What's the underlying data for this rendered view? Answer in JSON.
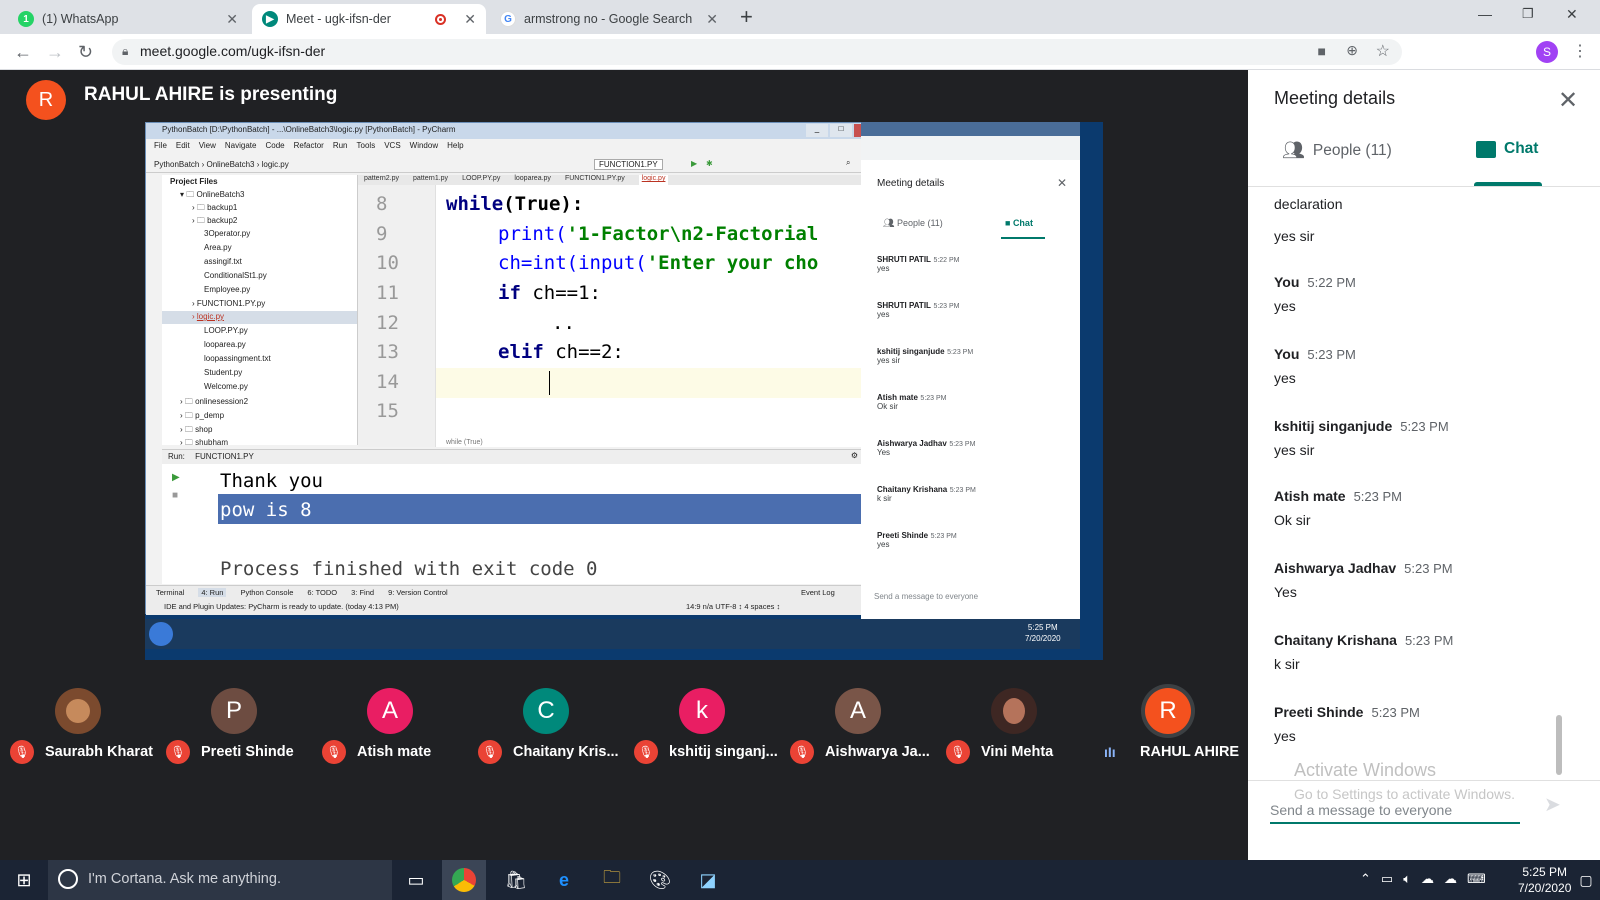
{
  "browser": {
    "tabs": [
      {
        "title": "(1) WhatsApp",
        "icon": "whatsapp-icon"
      },
      {
        "title": "Meet - ugk-ifsn-der",
        "icon": "meet-icon"
      },
      {
        "title": "armstrong no - Google Search",
        "icon": "google-icon"
      }
    ],
    "new_tab": "+",
    "url": "meet.google.com/ugk-ifsn-der",
    "profile_initial": "S"
  },
  "meet": {
    "presenter_initial": "R",
    "presenter_text": "RAHUL AHIRE is presenting",
    "participants": [
      {
        "name": "Saurabh Kharat",
        "initial": "",
        "color": "#7b4a2e",
        "muted": true
      },
      {
        "name": "Preeti Shinde",
        "initial": "P",
        "color": "#6d4c41",
        "muted": true
      },
      {
        "name": "Atish mate",
        "initial": "A",
        "color": "#e91e63",
        "muted": true
      },
      {
        "name": "Chaitany Kris...",
        "initial": "C",
        "color": "#00897b",
        "muted": true
      },
      {
        "name": "kshitij singanj...",
        "initial": "k",
        "color": "#e91e63",
        "muted": true
      },
      {
        "name": "Aishwarya Ja...",
        "initial": "A",
        "color": "#795548",
        "muted": true
      },
      {
        "name": "Vini Mehta",
        "initial": "",
        "color": "#5d4037",
        "muted": true
      },
      {
        "name": "RAHUL AHIRE",
        "initial": "R",
        "color": "#f4511e",
        "muted": false
      }
    ]
  },
  "pycharm": {
    "title": "PythonBatch [D:\\PythonBatch] - ...\\OnlineBatch3\\logic.py [PythonBatch] - PyCharm",
    "menu": [
      "File",
      "Edit",
      "View",
      "Navigate",
      "Code",
      "Refactor",
      "Run",
      "Tools",
      "VCS",
      "Window",
      "Help"
    ],
    "breadcrumb": "PythonBatch  ›  OnlineBatch3  ›  logic.py",
    "run_config": "FUNCTION1.PY",
    "project_header": "Project Files",
    "tree": [
      "OnlineBatch3",
      "backup1",
      "backup2",
      "3Operator.py",
      "Area.py",
      "assingif.txt",
      "ConditionalSt1.py",
      "Employee.py",
      "FUNCTION1.PY.py",
      "logic.py",
      "LOOP.PY.py",
      "looparea.py",
      "loopassingment.txt",
      "Student.py",
      "Welcome.py",
      "onlinesession2",
      "p_demp",
      "shop",
      "shubham"
    ],
    "editor_tabs": [
      "pattern2.py",
      "pattern1.py",
      "LOOP.PY.py",
      "looparea.py",
      "FUNCTION1.PY.py",
      "logic.py"
    ],
    "line_numbers": [
      "8",
      "9",
      "10",
      "11",
      "12",
      "13",
      "14",
      "15"
    ],
    "code_lines": {
      "l8_kw": "while",
      "l8_rest": "(True):",
      "l9_fn": "print(",
      "l9_str": "'1-Factor\\n2-Factorial",
      "l10_a": "ch=int(input(",
      "l10_str": "'Enter your cho",
      "l11_kw": "if",
      "l11_rest": " ch==1:",
      "l12": "..",
      "l13_kw": "elif",
      "l13_rest": " ch==2:"
    },
    "editor_hint": "while (True)",
    "run_label": "Run:",
    "run_tab": "FUNCTION1.PY",
    "output": [
      "Thank you",
      "pow is  8",
      "",
      "Process finished with exit code 0"
    ],
    "bottom_tabs": [
      "Terminal",
      "4: Run",
      "Python Console",
      "6: TODO",
      "3: Find",
      "9: Version Control",
      "Event Log"
    ],
    "status_msg": "IDE and Plugin Updates: PyCharm is ready to update. (today 4:13 PM)",
    "status_right": "14:9   n/a   UTF-8 ↕   4 spaces ↕"
  },
  "inner_panel": {
    "title": "Meeting details",
    "people_tab": "People (11)",
    "chat_tab": "Chat",
    "messages": [
      {
        "sender": "SHRUTI PATIL",
        "time": "5:22 PM",
        "text": "yes"
      },
      {
        "sender": "SHRUTI PATIL",
        "time": "5:23 PM",
        "text": "yes"
      },
      {
        "sender": "kshitij singanjude",
        "time": "5:23 PM",
        "text": "yes sir"
      },
      {
        "sender": "Atish mate",
        "time": "5:23 PM",
        "text": "Ok sir"
      },
      {
        "sender": "Aishwarya Jadhav",
        "time": "5:23 PM",
        "text": "Yes"
      },
      {
        "sender": "Chaitany Krishana",
        "time": "5:23 PM",
        "text": "k sir"
      },
      {
        "sender": "Preeti Shinde",
        "time": "5:23 PM",
        "text": "yes"
      }
    ],
    "input_placeholder": "Send a message to everyone",
    "clock_time": "5:25 PM",
    "clock_date": "7/20/2020"
  },
  "panel": {
    "title": "Meeting details",
    "people_tab": "People (11)",
    "chat_tab": "Chat",
    "partial_messages": [
      "declaration",
      "yes sir"
    ],
    "messages": [
      {
        "sender": "You",
        "time": "5:22 PM",
        "text": "yes"
      },
      {
        "sender": "You",
        "time": "5:23 PM",
        "text": "yes"
      },
      {
        "sender": "kshitij singanjude",
        "time": "5:23 PM",
        "text": "yes sir"
      },
      {
        "sender": "Atish mate",
        "time": "5:23 PM",
        "text": "Ok sir"
      },
      {
        "sender": "Aishwarya Jadhav",
        "time": "5:23 PM",
        "text": "Yes"
      },
      {
        "sender": "Chaitany Krishana",
        "time": "5:23 PM",
        "text": "k sir"
      },
      {
        "sender": "Preeti Shinde",
        "time": "5:23 PM",
        "text": "yes"
      }
    ],
    "activate_title": "Activate Windows",
    "activate_sub": "Go to Settings to activate Windows.",
    "input_placeholder": "Send a message to everyone"
  },
  "taskbar": {
    "cortana": "I'm Cortana. Ask me anything.",
    "time": "5:25 PM",
    "date": "7/20/2020"
  },
  "colors": {
    "meet_teal": "#00796b",
    "muted_red": "#ea4335",
    "meet_bg": "#202124"
  }
}
